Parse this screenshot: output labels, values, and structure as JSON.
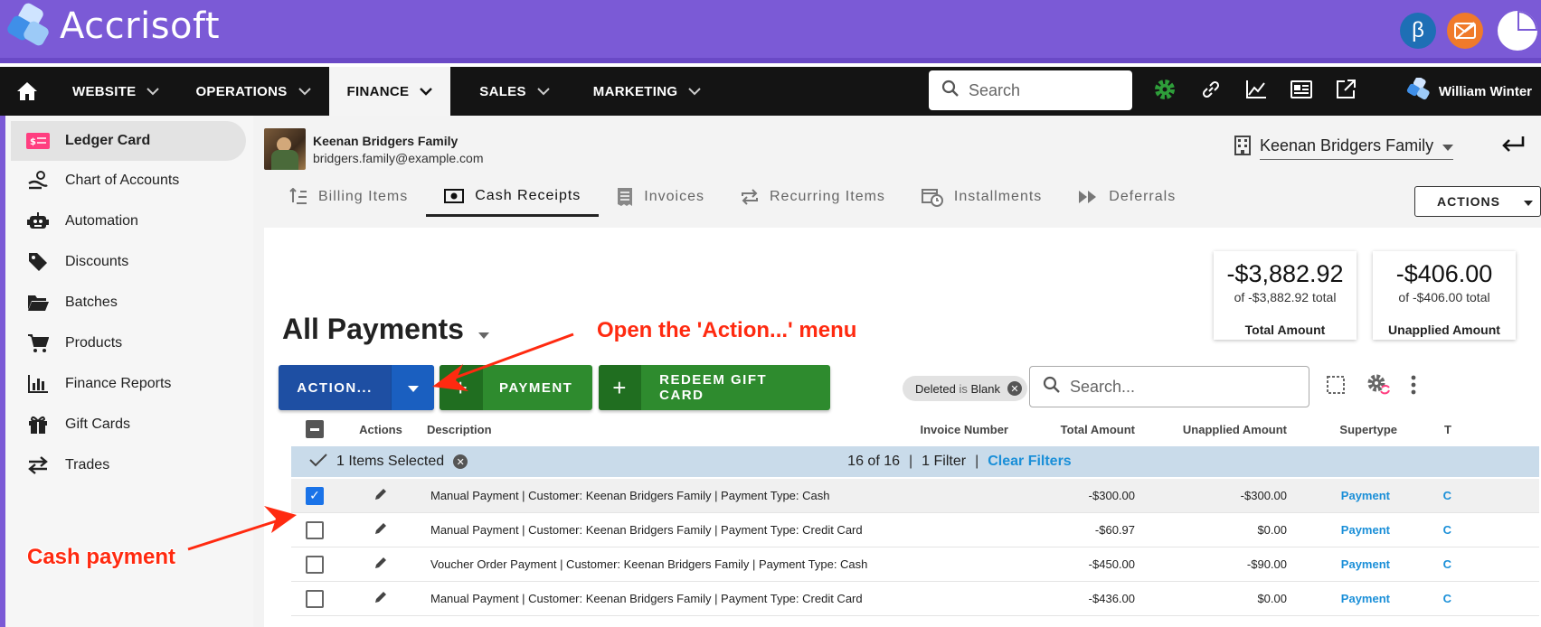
{
  "app": {
    "name": "Accrisoft"
  },
  "colors": {
    "brand": "#7b5ad6",
    "nav": "#141414",
    "primary_blue": "#1e4fa3",
    "green": "#2e8b2e",
    "link": "#1a8fd8",
    "annotation": "#ff2a10"
  },
  "top_icons": {
    "beta": "β"
  },
  "nav": {
    "items": [
      {
        "label": "WEBSITE"
      },
      {
        "label": "OPERATIONS"
      },
      {
        "label": "FINANCE"
      },
      {
        "label": "SALES"
      },
      {
        "label": "MARKETING"
      }
    ],
    "search_placeholder": "Search",
    "user": "William Winter"
  },
  "sidebar": {
    "items": [
      {
        "label": "Ledger Card",
        "icon": "ledger-card-icon"
      },
      {
        "label": "Chart of Accounts",
        "icon": "chart-accounts-icon"
      },
      {
        "label": "Automation",
        "icon": "robot-icon"
      },
      {
        "label": "Discounts",
        "icon": "tag-icon"
      },
      {
        "label": "Batches",
        "icon": "folder-icon"
      },
      {
        "label": "Products",
        "icon": "cart-icon"
      },
      {
        "label": "Finance Reports",
        "icon": "bar-chart-icon"
      },
      {
        "label": "Gift Cards",
        "icon": "gift-icon"
      },
      {
        "label": "Trades",
        "icon": "swap-icon"
      }
    ]
  },
  "family": {
    "name": "Keenan Bridgers Family",
    "email": "bridgers.family@example.com",
    "selected": "Keenan Bridgers Family"
  },
  "tabs": [
    {
      "label": "Billing Items"
    },
    {
      "label": "Cash Receipts"
    },
    {
      "label": "Invoices"
    },
    {
      "label": "Recurring Items"
    },
    {
      "label": "Installments"
    },
    {
      "label": "Deferrals"
    }
  ],
  "actions_button": "ACTIONS",
  "cards": [
    {
      "value": "-$3,882.92",
      "sub": "of -$3,882.92 total",
      "label": "Total Amount"
    },
    {
      "value": "-$406.00",
      "sub": "of -$406.00 total",
      "label": "Unapplied Amount"
    }
  ],
  "list": {
    "title": "All Payments",
    "action_button": "ACTION...",
    "payment_button": "PAYMENT",
    "gift_button": "REDEEM GIFT CARD",
    "filter_chip": {
      "field": "Deleted",
      "op": "is",
      "value": "Blank"
    },
    "search_placeholder": "Search...",
    "headers": {
      "actions": "Actions",
      "description": "Description",
      "invoice": "Invoice Number",
      "total": "Total Amount",
      "unapplied": "Unapplied Amount",
      "supertype": "Supertype",
      "extra": "T"
    },
    "selection": {
      "text": "1 Items Selected",
      "count": "16 of 16",
      "filters": "1 Filter",
      "clear": "Clear Filters"
    },
    "rows": [
      {
        "description": "Manual Payment | Customer: Keenan Bridgers Family | Payment Type: Cash",
        "total": "-$300.00",
        "unapplied": "-$300.00",
        "supertype": "Payment",
        "checked": true,
        "extra": "C"
      },
      {
        "description": "Manual Payment | Customer: Keenan Bridgers Family | Payment Type: Credit Card",
        "total": "-$60.97",
        "unapplied": "$0.00",
        "supertype": "Payment",
        "checked": false,
        "extra": "C"
      },
      {
        "description": "Voucher Order Payment | Customer: Keenan Bridgers Family | Payment Type: Cash",
        "total": "-$450.00",
        "unapplied": "-$90.00",
        "supertype": "Payment",
        "checked": false,
        "extra": "C"
      },
      {
        "description": "Manual Payment | Customer: Keenan Bridgers Family | Payment Type: Credit Card",
        "total": "-$436.00",
        "unapplied": "$0.00",
        "supertype": "Payment",
        "checked": false,
        "extra": "C"
      }
    ]
  },
  "annotations": {
    "action_menu": "Open the 'Action...' menu",
    "cash_payment": "Cash payment"
  }
}
